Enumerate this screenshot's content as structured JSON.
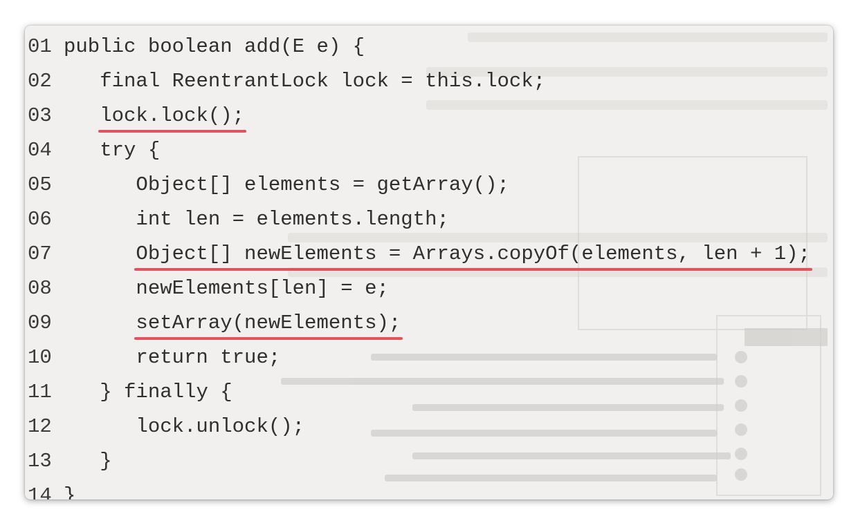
{
  "code_lines": [
    {
      "num": "01",
      "indent": "",
      "pre": "public boolean add(E e) {",
      "hl": "",
      "post": ""
    },
    {
      "num": "02",
      "indent": "   ",
      "pre": "final ReentrantLock lock = this.lock;",
      "hl": "",
      "post": ""
    },
    {
      "num": "03",
      "indent": "   ",
      "pre": "",
      "hl": "lock.lock();",
      "post": ""
    },
    {
      "num": "04",
      "indent": "   ",
      "pre": "try {",
      "hl": "",
      "post": ""
    },
    {
      "num": "05",
      "indent": "      ",
      "pre": "Object[] elements = getArray();",
      "hl": "",
      "post": ""
    },
    {
      "num": "06",
      "indent": "      ",
      "pre": "int len = elements.length;",
      "hl": "",
      "post": ""
    },
    {
      "num": "07",
      "indent": "      ",
      "pre": "",
      "hl": "Object[] newElements = Arrays.copyOf(elements, len + 1);",
      "post": ""
    },
    {
      "num": "08",
      "indent": "      ",
      "pre": "newElements[len] = e;",
      "hl": "",
      "post": ""
    },
    {
      "num": "09",
      "indent": "      ",
      "pre": "",
      "hl": "setArray(newElements);",
      "post": ""
    },
    {
      "num": "10",
      "indent": "      ",
      "pre": "return true;",
      "hl": "",
      "post": ""
    },
    {
      "num": "11",
      "indent": "   ",
      "pre": "} finally {",
      "hl": "",
      "post": ""
    },
    {
      "num": "12",
      "indent": "      ",
      "pre": "lock.unlock();",
      "hl": "",
      "post": ""
    },
    {
      "num": "13",
      "indent": "   ",
      "pre": "}",
      "hl": "",
      "post": ""
    },
    {
      "num": "14",
      "indent": "",
      "pre": "}",
      "hl": "",
      "post": ""
    }
  ],
  "colors": {
    "background": "#f1f0ee",
    "text": "#2f2f2f",
    "highlight_underline": "#e4525c"
  }
}
